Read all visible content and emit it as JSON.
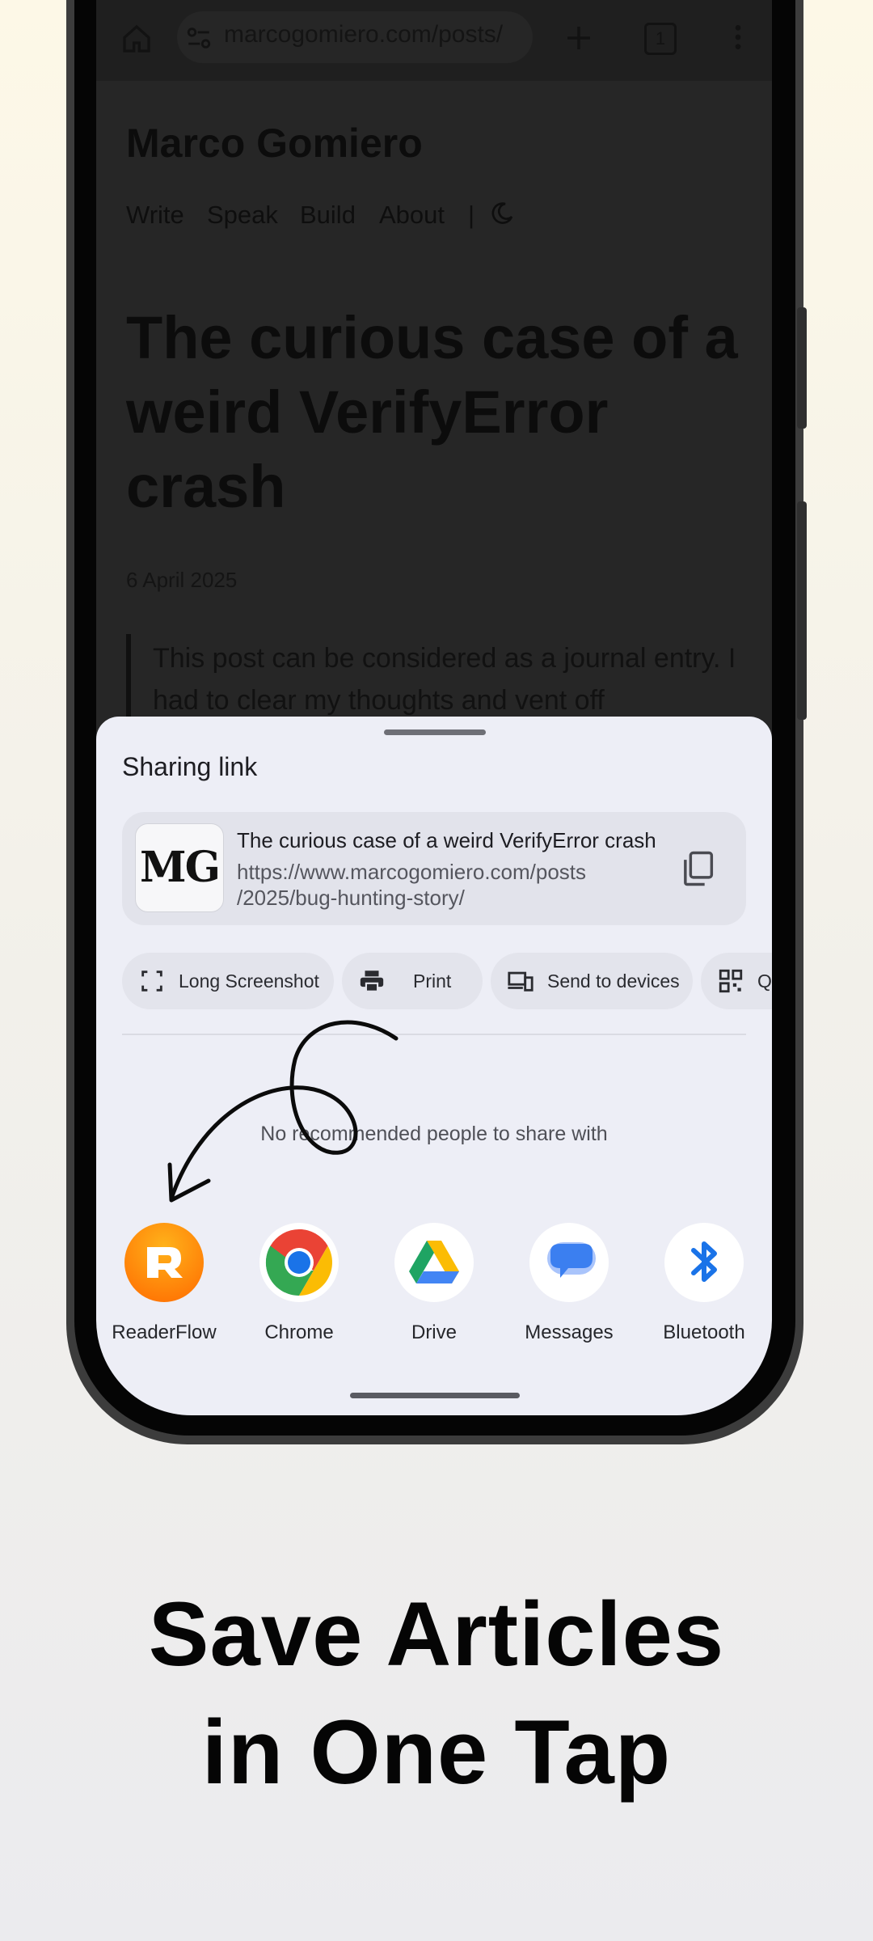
{
  "browser": {
    "url": "marcogomiero.com/posts/",
    "tab_count": "1",
    "site_title": "Marco Gomiero",
    "nav": [
      "Write",
      "Speak",
      "Build",
      "About"
    ],
    "nav_separator": "|",
    "article_title": "The curious case of a weird VerifyError crash",
    "date": "6 April 2025",
    "quote": "This post can be considered as a journal entry. I had to clear my thoughts and vent off"
  },
  "share_sheet": {
    "title": "Sharing link",
    "preview": {
      "thumb_text": "MG",
      "title": "The curious case of a weird VerifyError crash",
      "url_line1": "https://www.marcogomiero.com/posts",
      "url_line2": "/2025/bug-hunting-story/"
    },
    "actions": [
      {
        "label": "Long Screenshot",
        "icon": "long-screenshot-icon"
      },
      {
        "label": "Print",
        "icon": "print-icon"
      },
      {
        "label": "Send to devices",
        "icon": "devices-icon"
      },
      {
        "label": "QR",
        "icon": "qr-code-icon"
      }
    ],
    "no_recommendations": "No recommended people to share with",
    "apps": [
      {
        "label": "ReaderFlow",
        "icon": "readerflow-icon"
      },
      {
        "label": "Chrome",
        "icon": "chrome-icon"
      },
      {
        "label": "Drive",
        "icon": "drive-icon"
      },
      {
        "label": "Messages",
        "icon": "messages-icon"
      },
      {
        "label": "Bluetooth",
        "icon": "bluetooth-icon"
      }
    ]
  },
  "tagline": {
    "line1": "Save Articles",
    "line2": "in One Tap"
  },
  "colors": {
    "readerflow": "#ff8a00",
    "bluetooth": "#1a73e8",
    "messages": "#3b7ff0"
  }
}
